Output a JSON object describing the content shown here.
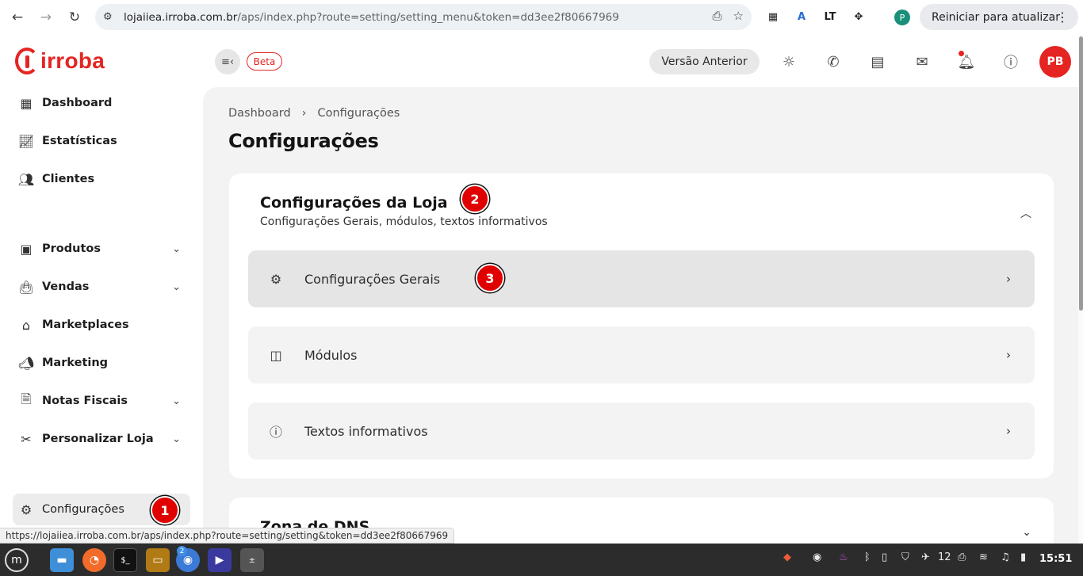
{
  "browser": {
    "url_host": "lojaiiea.irroba.com.br",
    "url_path": "/aps/index.php?route=setting/setting_menu&token=dd3ee2f80667969",
    "update_label": "Reiniciar para atualizar",
    "profile_initial": "P",
    "status_url": "https://lojaiiea.irroba.com.br/aps/index.php?route=setting/setting&token=dd3ee2f80667969",
    "extensions": [
      "qr-code-icon",
      "translate-icon",
      "lt-icon",
      "puzzle-icon"
    ]
  },
  "header": {
    "logo_text": "irroba",
    "beta_label": "Beta",
    "versao_label": "Versão Anterior",
    "avatar_initials": "PB",
    "brand_color": "#e52521"
  },
  "sidebar": {
    "items": [
      {
        "label": "Dashboard",
        "icon": "dashboard-icon"
      },
      {
        "label": "Estatísticas",
        "icon": "chart-icon"
      },
      {
        "label": "Clientes",
        "icon": "users-icon"
      },
      {
        "label": "Produtos",
        "icon": "box-icon"
      },
      {
        "label": "Vendas",
        "icon": "bag-icon"
      },
      {
        "label": "Marketplaces",
        "icon": "store-icon"
      },
      {
        "label": "Marketing",
        "icon": "megaphone-icon"
      },
      {
        "label": "Notas Fiscais",
        "icon": "document-icon"
      },
      {
        "label": "Personalizar Loja",
        "icon": "tools-icon"
      }
    ],
    "active_item": {
      "label": "Configurações",
      "icon": "gear-icon"
    }
  },
  "main": {
    "breadcrumb": [
      "Dashboard",
      "Configurações"
    ],
    "page_title": "Configurações",
    "section": {
      "title": "Configurações da Loja",
      "subtitle": "Configurações Gerais, módulos, textos informativos",
      "rows": [
        {
          "label": "Configurações Gerais",
          "icon": "gear-sparkle-icon"
        },
        {
          "label": "Módulos",
          "icon": "layout-icon"
        },
        {
          "label": "Textos informativos",
          "icon": "info-icon"
        }
      ]
    },
    "section2": {
      "title": "Zona de DNS",
      "subtitle": ""
    }
  },
  "markers": [
    "1",
    "2",
    "3"
  ],
  "taskbar": {
    "clock": "15:51",
    "tray_count": "12",
    "chrome_badge": "2"
  }
}
